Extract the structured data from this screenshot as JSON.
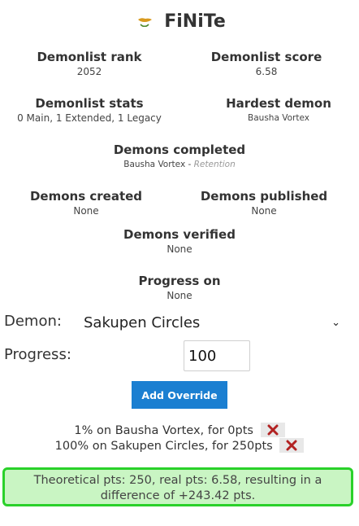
{
  "player": {
    "name": "FiNiTe",
    "flag_icon": "cyprus-flag-icon"
  },
  "stats": {
    "rank_label": "Demonlist rank",
    "rank_value": "2052",
    "score_label": "Demonlist score",
    "score_value": "6.58",
    "list_stats_label": "Demonlist stats",
    "list_stats_value": "0 Main, 1 Extended, 1 Legacy",
    "hardest_label": "Hardest demon",
    "hardest_value": "Bausha Vortex",
    "completed_label": "Demons completed",
    "completed_value": "Bausha Vortex",
    "completed_sep": " - ",
    "completed_extra": "Retention",
    "created_label": "Demons created",
    "created_value": "None",
    "published_label": "Demons published",
    "published_value": "None",
    "verified_label": "Demons verified",
    "verified_value": "None",
    "progress_label": "Progress on",
    "progress_value": "None"
  },
  "form": {
    "demon_label": "Demon:",
    "demon_selected": "Sakupen Circles",
    "progress_label": "Progress:",
    "progress_value": "100",
    "add_button": "Add Override"
  },
  "overrides": [
    {
      "text": "1% on Bausha Vortex, for 0pts"
    },
    {
      "text": "100% on Sakupen Circles, for 250pts"
    }
  ],
  "result": {
    "line1": "Theoretical pts: 250, real pts: 6.58, resulting in a",
    "line2": "difference of +243.42 pts."
  },
  "colors": {
    "accent_button": "#1b7fd1",
    "result_border": "#2ad12a",
    "result_background": "#c9f5c3",
    "delete_icon": "#b22222"
  }
}
